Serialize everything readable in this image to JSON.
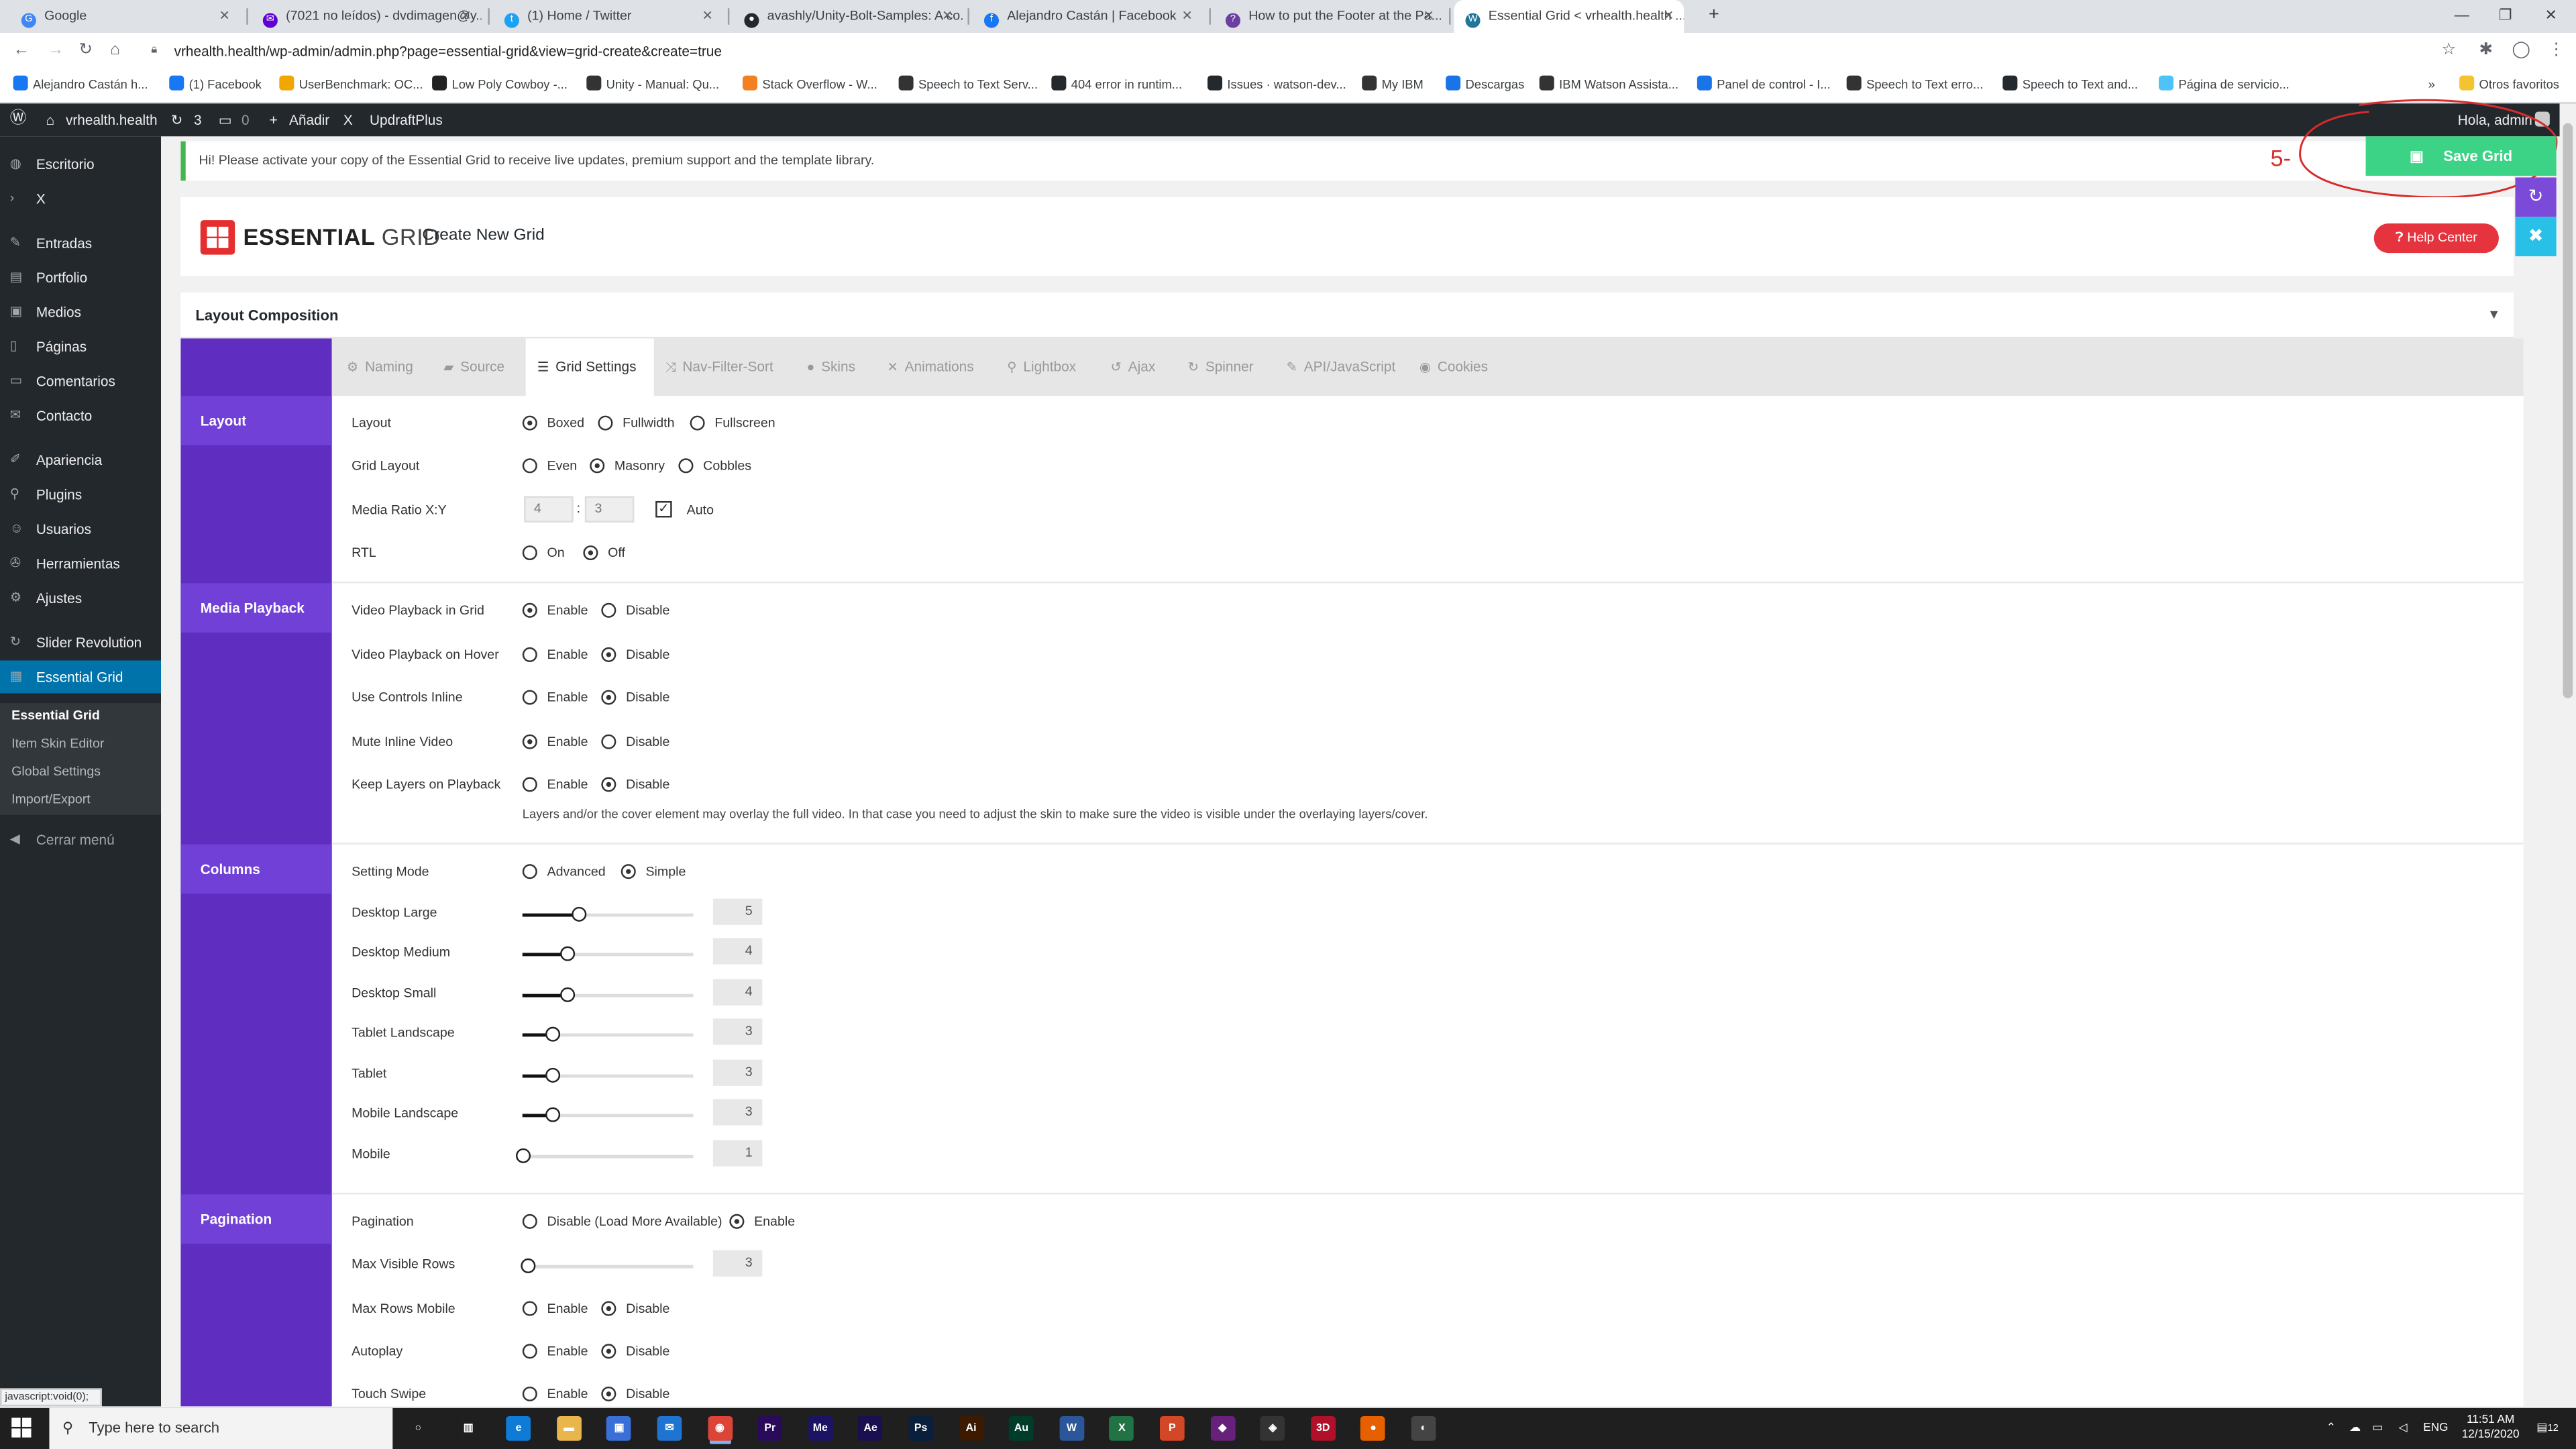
{
  "browser": {
    "tabs": [
      {
        "label": "Google",
        "icon": "google-icon",
        "color": "#4285f4",
        "glyph": "G"
      },
      {
        "label": "(7021 no leídos) - dvdimagen@y...",
        "icon": "yahoo-mail-icon",
        "color": "#6001d2",
        "glyph": "✉"
      },
      {
        "label": "(1) Home / Twitter",
        "icon": "twitter-icon",
        "color": "#1da1f2",
        "glyph": "t"
      },
      {
        "label": "avashly/Unity-Bolt-Samples: A co...",
        "icon": "github-icon",
        "color": "#24292e",
        "glyph": "●"
      },
      {
        "label": "Alejandro Castán | Facebook",
        "icon": "facebook-icon",
        "color": "#1877f2",
        "glyph": "f"
      },
      {
        "label": "How to put the Footer at the Pa...",
        "icon": "quora-icon",
        "color": "#6b3fa0",
        "glyph": "?"
      },
      {
        "label": "Essential Grid < vrhealth.health ...",
        "icon": "wordpress-icon",
        "color": "#21759b",
        "glyph": "W"
      }
    ],
    "url": "vrhealth.health/wp-admin/admin.php?page=essential-grid&view=grid-create&create=true",
    "bookmarks": [
      {
        "label": "Alejandro Castán h...",
        "color": "#1877f2"
      },
      {
        "label": "(1) Facebook",
        "color": "#1877f2"
      },
      {
        "label": "UserBenchmark: OC...",
        "color": "#f0a800"
      },
      {
        "label": "Low Poly Cowboy -...",
        "color": "#222222"
      },
      {
        "label": "Unity - Manual: Qu...",
        "color": "#333333"
      },
      {
        "label": "Stack Overflow - W...",
        "color": "#f48024"
      },
      {
        "label": "Speech to Text Serv...",
        "color": "#333333"
      },
      {
        "label": "404 error in runtim...",
        "color": "#24292e"
      },
      {
        "label": "Issues · watson-dev...",
        "color": "#24292e"
      },
      {
        "label": "My IBM",
        "color": "#333333"
      },
      {
        "label": "Descargas",
        "color": "#1a73e8"
      },
      {
        "label": "IBM Watson Assista...",
        "color": "#333333"
      },
      {
        "label": "Panel de control - I...",
        "color": "#1a73e8"
      },
      {
        "label": "Speech to Text erro...",
        "color": "#333333"
      },
      {
        "label": "Speech to Text and...",
        "color": "#24292e"
      },
      {
        "label": "Página de servicio...",
        "color": "#4fc3f7"
      }
    ],
    "more_bookmarks": "»",
    "other_bookmarks": "Otros favoritos"
  },
  "adminbar": {
    "site": "vrhealth.health",
    "updates": "3",
    "comments": "0",
    "add": "Añadir",
    "x": "X",
    "updraft": "UpdraftPlus",
    "greeting": "Hola, admin"
  },
  "sidebar": {
    "items": [
      {
        "label": "Escritorio",
        "icon": "dashboard-icon",
        "glyph": "◍"
      },
      {
        "label": "X",
        "icon": "chevron-right-icon",
        "glyph": "›"
      },
      {
        "label": "Entradas",
        "icon": "pin-icon",
        "glyph": "✎"
      },
      {
        "label": "Portfolio",
        "icon": "portfolio-icon",
        "glyph": "▤"
      },
      {
        "label": "Medios",
        "icon": "media-icon",
        "glyph": "▣"
      },
      {
        "label": "Páginas",
        "icon": "pages-icon",
        "glyph": "▯"
      },
      {
        "label": "Comentarios",
        "icon": "comments-icon",
        "glyph": "▭"
      },
      {
        "label": "Contacto",
        "icon": "mail-icon",
        "glyph": "✉"
      },
      {
        "label": "Apariencia",
        "icon": "brush-icon",
        "glyph": "✐"
      },
      {
        "label": "Plugins",
        "icon": "plug-icon",
        "glyph": "⚲"
      },
      {
        "label": "Usuarios",
        "icon": "users-icon",
        "glyph": "☺"
      },
      {
        "label": "Herramientas",
        "icon": "wrench-icon",
        "glyph": "✇"
      },
      {
        "label": "Ajustes",
        "icon": "settings-icon",
        "glyph": "⚙"
      },
      {
        "label": "Slider Revolution",
        "icon": "refresh-icon",
        "glyph": "↻"
      },
      {
        "label": "Essential Grid",
        "icon": "grid-icon",
        "glyph": "▦"
      }
    ],
    "submenu": [
      "Essential Grid",
      "Item Skin Editor",
      "Global Settings",
      "Import/Export"
    ],
    "collapse": "Cerrar menú"
  },
  "notice": "Hi! Please activate your copy of the Essential Grid to receive live updates, premium support and the template library.",
  "annotation": "5-",
  "save_grid": "Save Grid",
  "header": {
    "brand_bold": "ESSENTIAL",
    "brand_light": "GRID",
    "title": "Create New Grid",
    "help": "Help Center"
  },
  "layout_composition": "Layout Composition",
  "tabs": [
    {
      "label": "Naming",
      "icon": "gear-icon",
      "glyph": "⚙"
    },
    {
      "label": "Source",
      "icon": "layers-icon",
      "glyph": "▰"
    },
    {
      "label": "Grid Settings",
      "icon": "menu-icon",
      "glyph": "☰"
    },
    {
      "label": "Nav-Filter-Sort",
      "icon": "shuffle-icon",
      "glyph": "⤨"
    },
    {
      "label": "Skins",
      "icon": "drop-icon",
      "glyph": "●"
    },
    {
      "label": "Animations",
      "icon": "tools-icon",
      "glyph": "✕"
    },
    {
      "label": "Lightbox",
      "icon": "search-icon",
      "glyph": "⚲"
    },
    {
      "label": "Ajax",
      "icon": "undo-icon",
      "glyph": "↺"
    },
    {
      "label": "Spinner",
      "icon": "history-icon",
      "glyph": "↻"
    },
    {
      "label": "API/JavaScript",
      "icon": "pen-icon",
      "glyph": "✎"
    },
    {
      "label": "Cookies",
      "icon": "eye-icon",
      "glyph": "◉"
    }
  ],
  "sections": {
    "layout": "Layout",
    "media": "Media Playback",
    "columns": "Columns",
    "pagination": "Pagination"
  },
  "layout_rows": [
    {
      "label": "Layout",
      "options": [
        "Boxed",
        "Fullwidth",
        "Fullscreen"
      ],
      "selected": 0
    },
    {
      "label": "Grid Layout",
      "options": [
        "Even",
        "Masonry",
        "Cobbles"
      ],
      "selected": 1
    },
    {
      "label": "Media Ratio X:Y",
      "x": "4",
      "y": "3",
      "sep": ":",
      "auto": "Auto",
      "check": "✓"
    },
    {
      "label": "RTL",
      "options": [
        "On",
        "Off"
      ],
      "selected": 1
    }
  ],
  "media_rows": [
    {
      "label": "Video Playback in Grid",
      "options": [
        "Enable",
        "Disable"
      ],
      "selected": 0
    },
    {
      "label": "Video Playback on Hover",
      "options": [
        "Enable",
        "Disable"
      ],
      "selected": 1
    },
    {
      "label": "Use Controls Inline",
      "options": [
        "Enable",
        "Disable"
      ],
      "selected": 1
    },
    {
      "label": "Mute Inline Video",
      "options": [
        "Enable",
        "Disable"
      ],
      "selected": 0
    },
    {
      "label": "Keep Layers on Playback",
      "options": [
        "Enable",
        "Disable"
      ],
      "selected": 1
    }
  ],
  "media_note": "Layers and/or the cover element may overlay the full video. In that case you need to adjust the skin to make sure the video is visible under the overlaying layers/cover.",
  "setting_mode": {
    "label": "Setting Mode",
    "options": [
      "Advanced",
      "Simple"
    ],
    "selected": 1
  },
  "columns": [
    {
      "label": "Desktop Large",
      "value": "5",
      "fraction": 0.33
    },
    {
      "label": "Desktop Medium",
      "value": "4",
      "fraction": 0.26
    },
    {
      "label": "Desktop Small",
      "value": "4",
      "fraction": 0.26
    },
    {
      "label": "Tablet Landscape",
      "value": "3",
      "fraction": 0.18
    },
    {
      "label": "Tablet",
      "value": "3",
      "fraction": 0.18
    },
    {
      "label": "Mobile Landscape",
      "value": "3",
      "fraction": 0.18
    },
    {
      "label": "Mobile",
      "value": "1",
      "fraction": 0.0
    }
  ],
  "pagination_rows": [
    {
      "label": "Pagination",
      "options": [
        "Disable (Load More Available)",
        "Enable"
      ],
      "selected": 1
    },
    {
      "label": "Max Visible Rows",
      "value": "3",
      "fraction": 0.03
    },
    {
      "label": "Max Rows Mobile",
      "options": [
        "Enable",
        "Disable"
      ],
      "selected": 1
    },
    {
      "label": "Autoplay",
      "options": [
        "Enable",
        "Disable"
      ],
      "selected": 1
    },
    {
      "label": "Touch Swipe",
      "options": [
        "Enable",
        "Disable"
      ],
      "selected": 1
    }
  ],
  "statusbar": "javascript:void(0);",
  "taskbar": {
    "search": "Type here to search",
    "apps": [
      {
        "icon": "cortana-icon",
        "glyph": "○",
        "color": "#1f1f1f"
      },
      {
        "icon": "task-view-icon",
        "glyph": "▥",
        "color": "#1f1f1f"
      },
      {
        "icon": "edge-icon",
        "glyph": "e",
        "color": "#0f7bd6"
      },
      {
        "icon": "explorer-icon",
        "glyph": "▬",
        "color": "#e8b64a"
      },
      {
        "icon": "store-icon",
        "glyph": "▣",
        "color": "#3a6fd8"
      },
      {
        "icon": "mail-app-icon",
        "glyph": "✉",
        "color": "#1f74d1"
      },
      {
        "icon": "chrome-icon",
        "glyph": "◉",
        "color": "#db4437"
      },
      {
        "icon": "premiere-icon",
        "glyph": "Pr",
        "color": "#2a0a5a"
      },
      {
        "icon": "media-encoder-icon",
        "glyph": "Me",
        "color": "#1b1464"
      },
      {
        "icon": "after-effects-icon",
        "glyph": "Ae",
        "color": "#1a1050"
      },
      {
        "icon": "photoshop-icon",
        "glyph": "Ps",
        "color": "#0a1f3c"
      },
      {
        "icon": "illustrator-icon",
        "glyph": "Ai",
        "color": "#3b1a00"
      },
      {
        "icon": "audition-icon",
        "glyph": "Au",
        "color": "#003c2a"
      },
      {
        "icon": "word-icon",
        "glyph": "W",
        "color": "#2b579a"
      },
      {
        "icon": "excel-icon",
        "glyph": "X",
        "color": "#217346"
      },
      {
        "icon": "powerpoint-icon",
        "glyph": "P",
        "color": "#d24726"
      },
      {
        "icon": "visual-studio-icon",
        "glyph": "◆",
        "color": "#68217a"
      },
      {
        "icon": "unity-icon",
        "glyph": "◈",
        "color": "#333333"
      },
      {
        "icon": "hdr-app-icon",
        "glyph": "3D",
        "color": "#b0102a"
      },
      {
        "icon": "firefox-icon",
        "glyph": "●",
        "color": "#e66000"
      },
      {
        "icon": "app-icon",
        "glyph": "◐",
        "color": "#444444"
      }
    ],
    "lang": "ENG",
    "time": "11:51 AM",
    "date": "12/15/2020",
    "notif": "12"
  }
}
